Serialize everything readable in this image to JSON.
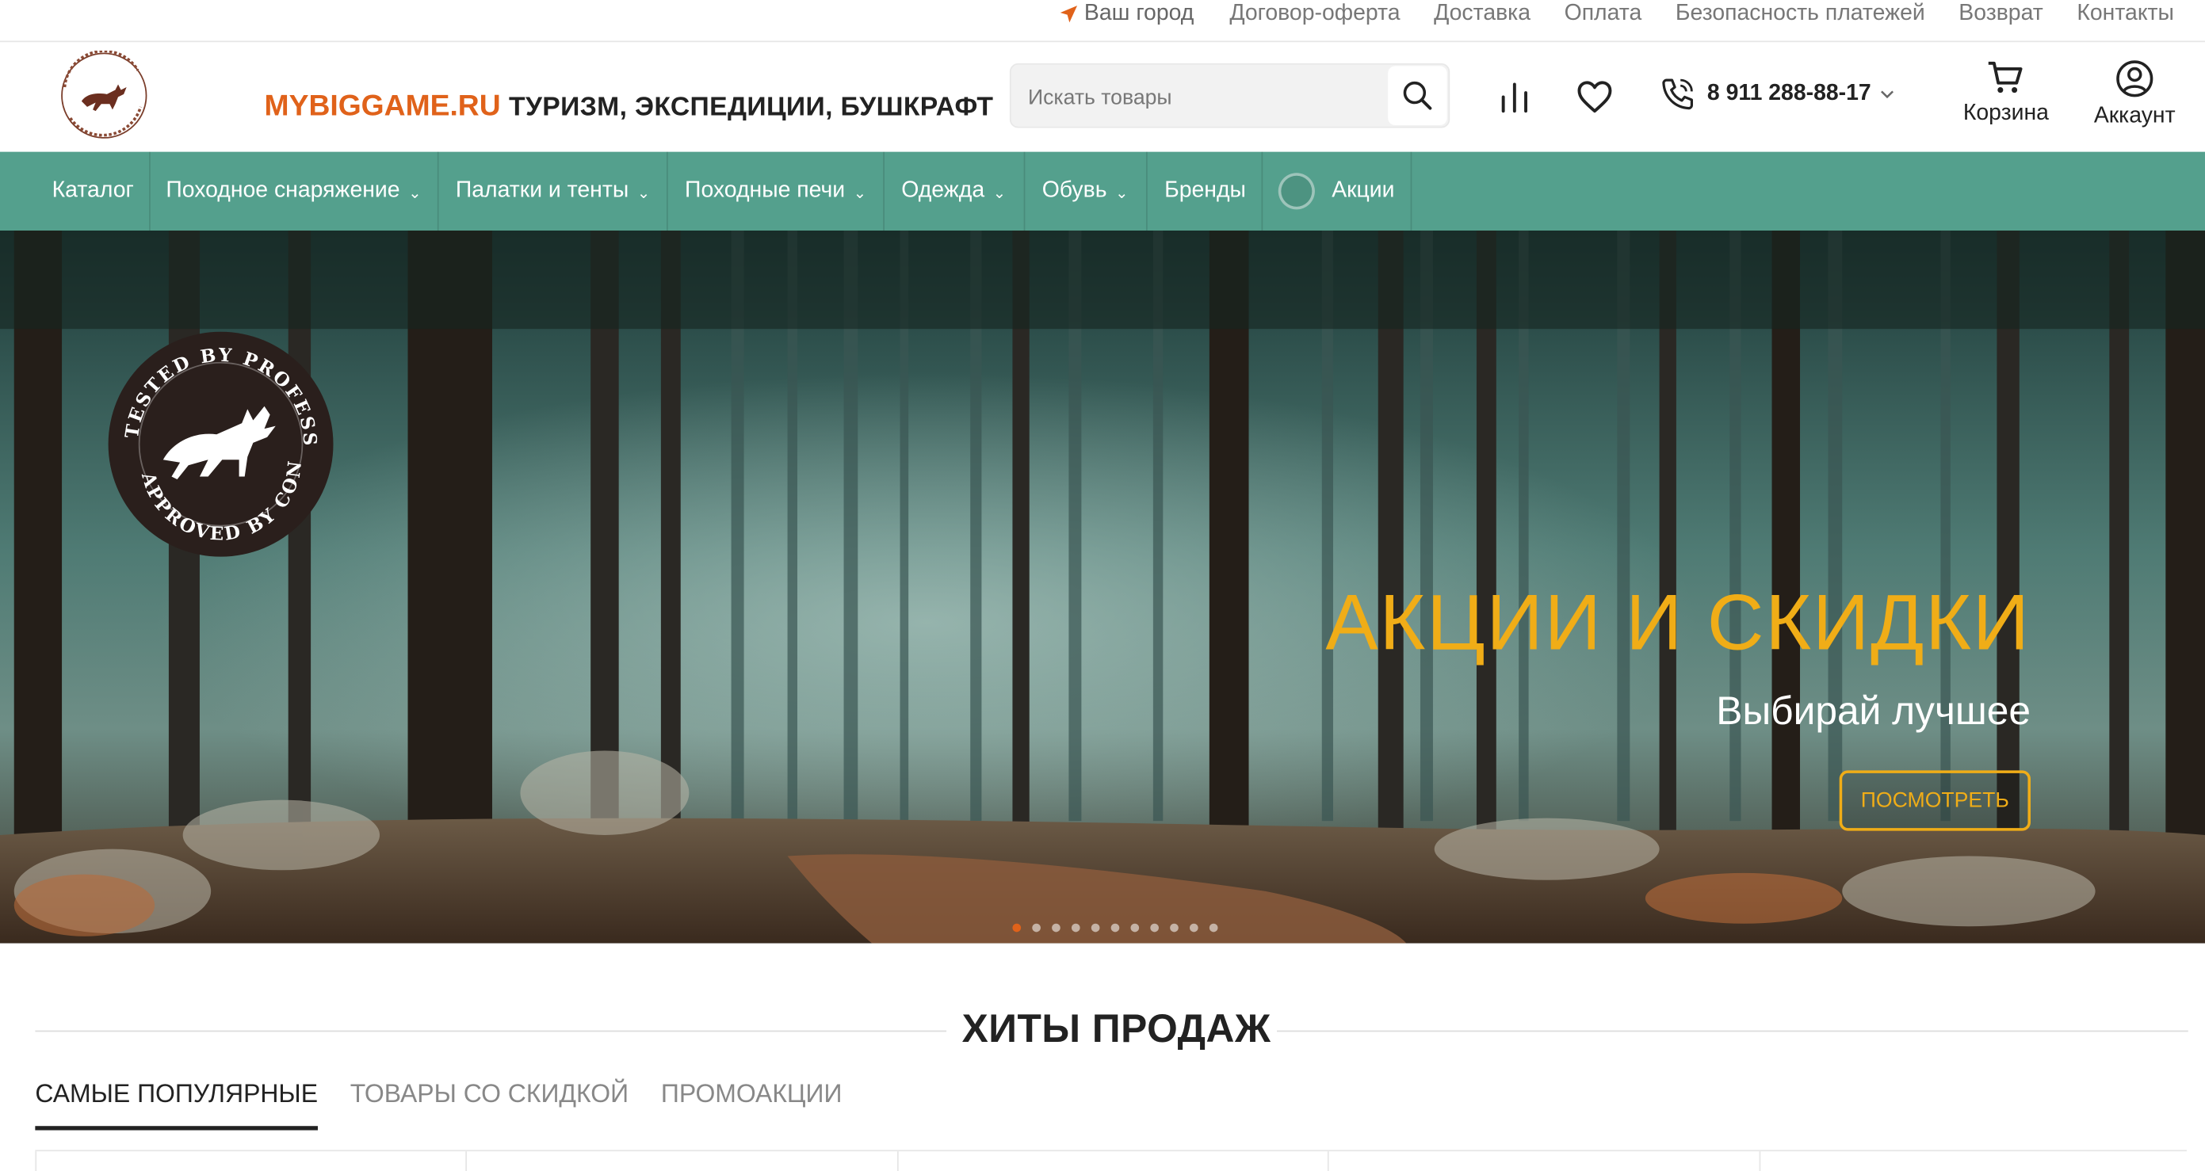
{
  "topbar": {
    "city": "Ваш город",
    "links": [
      "Договор-оферта",
      "Доставка",
      "Оплата",
      "Безопасность платежей",
      "Возврат",
      "Контакты"
    ]
  },
  "header": {
    "brand_primary": "MYBIGGAME.RU",
    "brand_secondary": "ТУРИЗМ, ЭКСПЕДИЦИИ, БУШКРАФТ",
    "search_placeholder": "Искать товары",
    "phone": "8 911 288-88-17",
    "cart_label": "Корзина",
    "account_label": "Аккаунт"
  },
  "nav": {
    "items": [
      "Каталог",
      "Походное снаряжение",
      "Палатки и тенты",
      "Походные печи",
      "Одежда",
      "Обувь",
      "Бренды",
      "Акции"
    ]
  },
  "hero": {
    "title": "АКЦИИ И СКИДКИ",
    "subtitle": "Выбирай лучшее",
    "button": "ПОСМОТРЕТЬ",
    "badge_text_top": "TESTED BY PROFESSIONALS",
    "badge_text_bottom": "APPROVED BY CONSUMERS",
    "slides_total": 11,
    "active_slide": 1
  },
  "section": {
    "title": "ХИТЫ ПРОДАЖ",
    "tabs": [
      "САМЫЕ ПОПУЛЯРНЫЕ",
      "ТОВАРЫ СО СКИДКОЙ",
      "ПРОМОАКЦИИ"
    ],
    "active_tab": 0
  },
  "colors": {
    "accent_orange": "#e0621a",
    "nav_green": "#54a08d",
    "hero_gold": "#f0ad17"
  }
}
